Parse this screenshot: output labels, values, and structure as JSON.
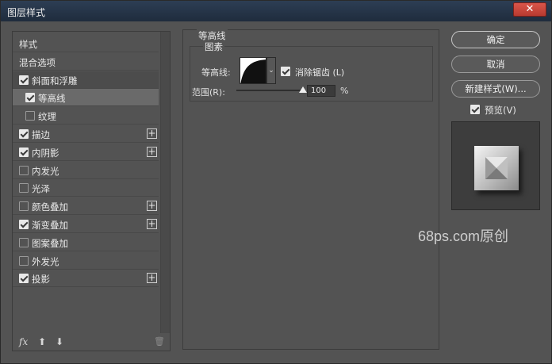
{
  "window": {
    "title": "图层样式",
    "close": "✕"
  },
  "sidebar": {
    "items": [
      {
        "label": "样式",
        "checkbox": null,
        "plus": false,
        "state": "none"
      },
      {
        "label": "混合选项",
        "checkbox": null,
        "plus": false,
        "state": "none"
      },
      {
        "label": "斜面和浮雕",
        "checkbox": true,
        "plus": false,
        "state": "parent"
      },
      {
        "label": "等高线",
        "checkbox": true,
        "plus": false,
        "state": "selected"
      },
      {
        "label": "纹理",
        "checkbox": false,
        "plus": false,
        "state": "sub"
      },
      {
        "label": "描边",
        "checkbox": true,
        "plus": true,
        "state": "none"
      },
      {
        "label": "内阴影",
        "checkbox": true,
        "plus": true,
        "state": "none"
      },
      {
        "label": "内发光",
        "checkbox": false,
        "plus": false,
        "state": "none"
      },
      {
        "label": "光泽",
        "checkbox": false,
        "plus": false,
        "state": "none"
      },
      {
        "label": "颜色叠加",
        "checkbox": false,
        "plus": true,
        "state": "none"
      },
      {
        "label": "渐变叠加",
        "checkbox": true,
        "plus": true,
        "state": "none"
      },
      {
        "label": "图案叠加",
        "checkbox": false,
        "plus": false,
        "state": "none"
      },
      {
        "label": "外发光",
        "checkbox": false,
        "plus": false,
        "state": "none"
      },
      {
        "label": "投影",
        "checkbox": true,
        "plus": true,
        "state": "none"
      }
    ],
    "footer": {
      "fx": "fx",
      "up": "⬆",
      "down": "⬇",
      "trash": "🗑"
    }
  },
  "contour": {
    "section_title": "等高线",
    "group_title": "图素",
    "contour_label": "等高线:",
    "antialias_label": "消除锯齿 (L)",
    "antialias_checked": true,
    "range_label": "范围(R):",
    "range_value": "100",
    "range_fraction": 1.0,
    "percent": "%"
  },
  "actions": {
    "ok": "确定",
    "cancel": "取消",
    "new_style": "新建样式(W)...",
    "preview_label": "预览(V)",
    "preview_checked": true
  },
  "watermark": "68ps.com原创"
}
